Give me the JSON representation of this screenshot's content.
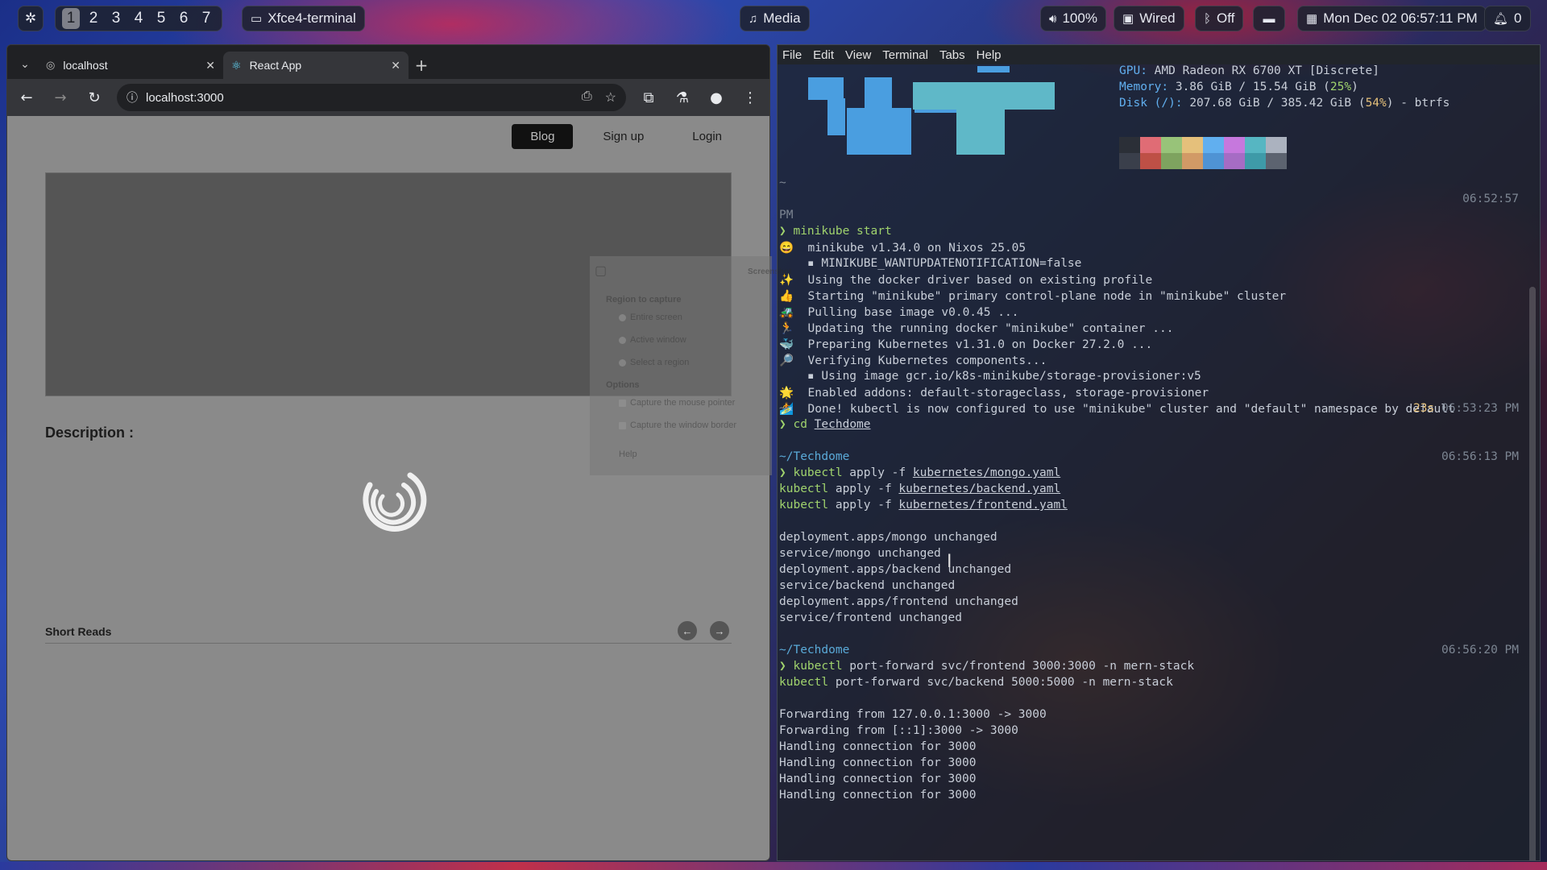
{
  "topbar": {
    "workspaces": [
      "1",
      "2",
      "3",
      "4",
      "5",
      "6",
      "7"
    ],
    "active_workspace": "1",
    "window_title": "Xfce4-terminal",
    "media_label": "Media",
    "volume": "100%",
    "network": "Wired",
    "bluetooth": "Off",
    "clock": "Mon Dec 02  06:57:11 PM",
    "notifications": "0",
    "icons": {
      "settings": "gear-icon",
      "terminal": "terminal-icon",
      "media": "music-note-icon",
      "volume": "speaker-icon",
      "network": "monitor-network-icon",
      "bluetooth": "bluetooth-icon",
      "screen": "screen-icon",
      "calendar": "calendar-icon",
      "bell": "bell-icon"
    }
  },
  "browser": {
    "tabs": [
      {
        "title": "localhost",
        "icon": "globe-icon"
      },
      {
        "title": "React App",
        "icon": "react-icon"
      }
    ],
    "active_tab": 1,
    "url": "localhost:3000",
    "page": {
      "nav": {
        "blog": "Blog",
        "signup": "Sign up",
        "login": "Login"
      },
      "description_label": "Description :",
      "short_reads_label": "Short Reads"
    },
    "ghost_dialog": {
      "title": "Screenshot",
      "region_heading": "Region to capture",
      "opt_entire": "Entire screen",
      "opt_active": "Active window",
      "opt_region": "Select a region",
      "options_heading": "Options",
      "opt_pointer": "Capture the mouse pointer",
      "opt_border": "Capture the window border",
      "help": "Help"
    }
  },
  "terminal": {
    "menu": [
      "File",
      "Edit",
      "View",
      "Terminal",
      "Tabs",
      "Help"
    ],
    "fetch": {
      "gpu_label": "GPU:",
      "gpu_value": "AMD Radeon RX 6700 XT [Discrete]",
      "memory_label": "Memory:",
      "memory_value": "3.86 GiB / 15.54 GiB (",
      "memory_pct": "25%",
      "memory_end": ")",
      "disk_label": "Disk (/):",
      "disk_value": "207.68 GiB / 385.42 GiB (",
      "disk_pct": "54%",
      "disk_end": ") - btrfs",
      "palette_top": [
        "#2b2f37",
        "#e06c75",
        "#98c379",
        "#e5c07b",
        "#61afef",
        "#c678dd",
        "#56b6c2",
        "#abb2bf"
      ],
      "palette_bottom": [
        "#3a3f4b",
        "#be5046",
        "#7ea35f",
        "#d19a66",
        "#4f93d4",
        "#a66cc4",
        "#3e9aa8",
        "#5c6370"
      ]
    },
    "block1": {
      "cwd": "~",
      "time": "06:52:57",
      "pm": "PM",
      "cmd": "minikube start",
      "lines": [
        "😄  minikube v1.34.0 on Nixos 25.05",
        "    ▪ MINIKUBE_WANTUPDATENOTIFICATION=false",
        "✨  Using the docker driver based on existing profile",
        "👍  Starting \"minikube\" primary control-plane node in \"minikube\" cluster",
        "🚜  Pulling base image v0.0.45 ...",
        "🏃  Updating the running docker \"minikube\" container ...",
        "🐳  Preparing Kubernetes v1.31.0 on Docker 27.2.0 ...",
        "🔎  Verifying Kubernetes components...",
        "    ▪ Using image gcr.io/k8s-minikube/storage-provisioner:v5",
        "🌟  Enabled addons: default-storageclass, storage-provisioner",
        "🏄  Done! kubectl is now configured to use \"minikube\" cluster and \"default\" namespace by default"
      ]
    },
    "block2": {
      "cwd": "~",
      "duration": "23s",
      "time": "06:53:23 PM",
      "cmd": "cd",
      "arg": "Techdome"
    },
    "block3": {
      "cwd": "~/Techdome",
      "time": "06:56:13 PM",
      "cmd": "kubectl",
      "cmd_args": [
        {
          "pre": "apply -f ",
          "file": "kubernetes/mongo.yaml"
        },
        {
          "pre": "apply -f ",
          "file": "kubernetes/backend.yaml"
        },
        {
          "pre": "apply -f ",
          "file": "kubernetes/frontend.yaml"
        }
      ],
      "output": [
        "deployment.apps/mongo unchanged",
        "service/mongo unchanged",
        "deployment.apps/backend unchanged",
        "service/backend unchanged",
        "deployment.apps/frontend unchanged",
        "service/frontend unchanged"
      ]
    },
    "block4": {
      "cwd": "~/Techdome",
      "time": "06:56:20 PM",
      "cmd": "kubectl",
      "cmd_args": [
        "port-forward svc/frontend 3000:3000 -n mern-stack",
        "port-forward svc/backend 5000:5000 -n mern-stack"
      ],
      "output": [
        "Forwarding from 127.0.0.1:3000 -> 3000",
        "Forwarding from [::1]:3000 -> 3000",
        "Handling connection for 3000",
        "Handling connection for 3000",
        "Handling connection for 3000",
        "Handling connection for 3000"
      ]
    },
    "prompt_symbol": "❯"
  }
}
